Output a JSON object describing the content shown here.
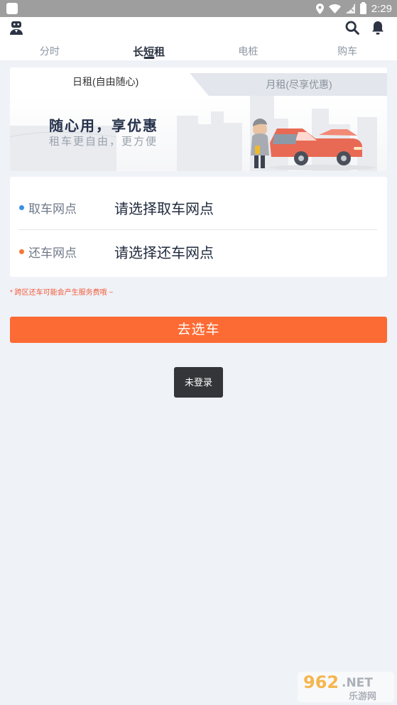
{
  "status_bar": {
    "time": "2:29"
  },
  "header": {
    "tabs": [
      {
        "label": "分时"
      },
      {
        "label": "长短租"
      },
      {
        "label": "电桩"
      },
      {
        "label": "购车"
      }
    ],
    "active_tab": 1,
    "icons": [
      "profile-icon",
      "search-icon",
      "bell-icon"
    ]
  },
  "rental": {
    "tab_daily": "日租(自由随心)",
    "tab_monthly": "月租(尽享优惠)",
    "banner_title": "随心用，享优惠",
    "banner_subtitle": "租车更自由，更方便"
  },
  "station": {
    "pickup_label": "取车网点",
    "pickup_value": "请选择取车网点",
    "return_label": "还车网点",
    "return_value": "请选择还车网点"
  },
  "notice": "* 跨区还车可能会产生服务费哦 ~",
  "go_button": "去选车",
  "toast": "未登录",
  "watermark": {
    "brand": "962.NET",
    "sub": "乐游网"
  },
  "colors": {
    "accent": "#fd6b34",
    "pickup_dot": "#3b8fe8",
    "return_dot": "#f5773a",
    "background": "#eff2f7"
  }
}
